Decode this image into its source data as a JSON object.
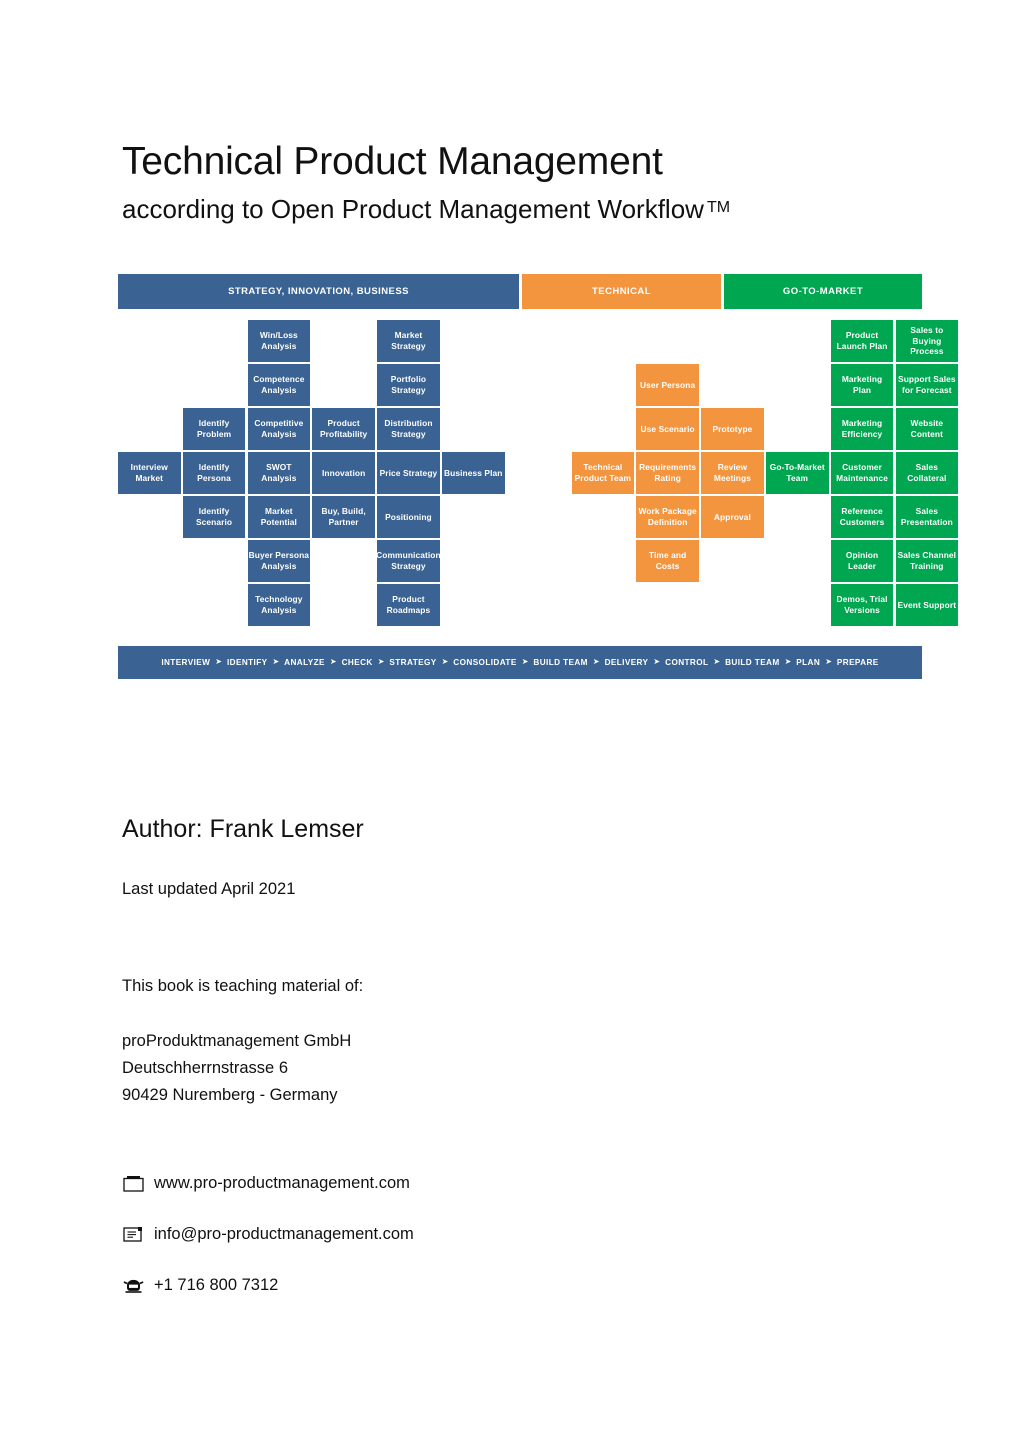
{
  "document": {
    "title": "Technical Product Management",
    "subtitle": "according to Open Product Management Workflow",
    "subtitle_tm": "TM",
    "author": "Author: Frank Lemser",
    "last_updated": "Last updated April 2021",
    "teaching_line": "This book is teaching material of:",
    "address": "proProduktmanagement GmbH\nDeutschherrnstrasse 6\n90429 Nuremberg - Germany"
  },
  "contacts": [
    {
      "icon": "website-icon",
      "glyph": "▭",
      "text": "www.pro-productmanagement.com"
    },
    {
      "icon": "email-icon",
      "glyph": "✉",
      "text": "info@pro-productmanagement.com"
    },
    {
      "icon": "phone-icon",
      "glyph": "☎",
      "text": "+1 716 800 7312"
    }
  ],
  "colors": {
    "blue": "#3A6293",
    "orange": "#F3953F",
    "green": "#00A650",
    "white": "#FFFFFF"
  },
  "diagram": {
    "bands": [
      {
        "label": "STRATEGY, INNOVATION, BUSINESS",
        "color": "blue"
      },
      {
        "label": "TECHNICAL",
        "color": "orange"
      },
      {
        "label": "GO-TO-MARKET",
        "color": "green"
      }
    ],
    "columns": [
      "Interview",
      "Identify",
      "Analyze",
      "Check",
      "Strategy",
      "Consolidate",
      "Build Team",
      "Delivery",
      "Control",
      "Build Team",
      "Plan",
      "Prepare"
    ],
    "cells": [
      {
        "label": "Win/Loss Analysis",
        "color": "blue",
        "col": 2,
        "row": 0
      },
      {
        "label": "Market Strategy",
        "color": "blue",
        "col": 4,
        "row": 0
      },
      {
        "label": "Product Launch Plan",
        "color": "green",
        "col": 11,
        "row": 0
      },
      {
        "label": "Sales to Buying Process",
        "color": "green",
        "col": 12,
        "row": 0
      },
      {
        "label": "Competence Analysis",
        "color": "blue",
        "col": 2,
        "row": 1
      },
      {
        "label": "Portfolio Strategy",
        "color": "blue",
        "col": 4,
        "row": 1
      },
      {
        "label": "User Persona",
        "color": "orange",
        "col": 8,
        "row": 1
      },
      {
        "label": "Marketing Plan",
        "color": "green",
        "col": 11,
        "row": 1
      },
      {
        "label": "Support Sales for Forecast",
        "color": "green",
        "col": 12,
        "row": 1
      },
      {
        "label": "Identify Problem",
        "color": "blue",
        "col": 1,
        "row": 2
      },
      {
        "label": "Competitive Analysis",
        "color": "blue",
        "col": 2,
        "row": 2
      },
      {
        "label": "Product Profitability",
        "color": "blue",
        "col": 3,
        "row": 2
      },
      {
        "label": "Distribution Strategy",
        "color": "blue",
        "col": 4,
        "row": 2
      },
      {
        "label": "Use Scenario",
        "color": "orange",
        "col": 8,
        "row": 2
      },
      {
        "label": "Prototype",
        "color": "orange",
        "col": 9,
        "row": 2
      },
      {
        "label": "Marketing Efficiency",
        "color": "green",
        "col": 11,
        "row": 2
      },
      {
        "label": "Website Content",
        "color": "green",
        "col": 12,
        "row": 2
      },
      {
        "label": "Interview Market",
        "color": "blue",
        "col": 0,
        "row": 3
      },
      {
        "label": "Identify Persona",
        "color": "blue",
        "col": 1,
        "row": 3
      },
      {
        "label": "SWOT Analysis",
        "color": "blue",
        "col": 2,
        "row": 3
      },
      {
        "label": "Innovation",
        "color": "blue",
        "col": 3,
        "row": 3
      },
      {
        "label": "Price Strategy",
        "color": "blue",
        "col": 4,
        "row": 3
      },
      {
        "label": "Business Plan",
        "color": "blue",
        "col": 5,
        "row": 3
      },
      {
        "label": "Technical Product Team",
        "color": "orange",
        "col": 7,
        "row": 3
      },
      {
        "label": "Requirements Rating",
        "color": "orange",
        "col": 8,
        "row": 3
      },
      {
        "label": "Review Meetings",
        "color": "orange",
        "col": 9,
        "row": 3
      },
      {
        "label": "Go-To-Market Team",
        "color": "green",
        "col": 10,
        "row": 3
      },
      {
        "label": "Customer Maintenance",
        "color": "green",
        "col": 11,
        "row": 3
      },
      {
        "label": "Sales Collateral",
        "color": "green",
        "col": 12,
        "row": 3
      },
      {
        "label": "Identify Scenario",
        "color": "blue",
        "col": 1,
        "row": 4
      },
      {
        "label": "Market Potential",
        "color": "blue",
        "col": 2,
        "row": 4
      },
      {
        "label": "Buy, Build, Partner",
        "color": "blue",
        "col": 3,
        "row": 4
      },
      {
        "label": "Positioning",
        "color": "blue",
        "col": 4,
        "row": 4
      },
      {
        "label": "Work Package Definition",
        "color": "orange",
        "col": 8,
        "row": 4
      },
      {
        "label": "Approval",
        "color": "orange",
        "col": 9,
        "row": 4
      },
      {
        "label": "Reference Customers",
        "color": "green",
        "col": 11,
        "row": 4
      },
      {
        "label": "Sales Presentation",
        "color": "green",
        "col": 12,
        "row": 4
      },
      {
        "label": "Buyer Persona Analysis",
        "color": "blue",
        "col": 2,
        "row": 5
      },
      {
        "label": "Communication Strategy",
        "color": "blue",
        "col": 4,
        "row": 5
      },
      {
        "label": "Time and Costs",
        "color": "orange",
        "col": 8,
        "row": 5
      },
      {
        "label": "Opinion Leader",
        "color": "green",
        "col": 11,
        "row": 5
      },
      {
        "label": "Sales Channel Training",
        "color": "green",
        "col": 12,
        "row": 5
      },
      {
        "label": "Technology Analysis",
        "color": "blue",
        "col": 2,
        "row": 6
      },
      {
        "label": "Product Roadmaps",
        "color": "blue",
        "col": 4,
        "row": 6
      },
      {
        "label": "Demos, Trial Versions",
        "color": "green",
        "col": 11,
        "row": 6
      },
      {
        "label": "Event Support",
        "color": "green",
        "col": 12,
        "row": 6
      }
    ],
    "steps": [
      "INTERVIEW",
      "IDENTIFY",
      "ANALYZE",
      "CHECK",
      "STRATEGY",
      "CONSOLIDATE",
      "BUILD TEAM",
      "DELIVERY",
      "CONTROL",
      "BUILD TEAM",
      "PLAN",
      "PREPARE"
    ],
    "step_arrow": "➤"
  }
}
